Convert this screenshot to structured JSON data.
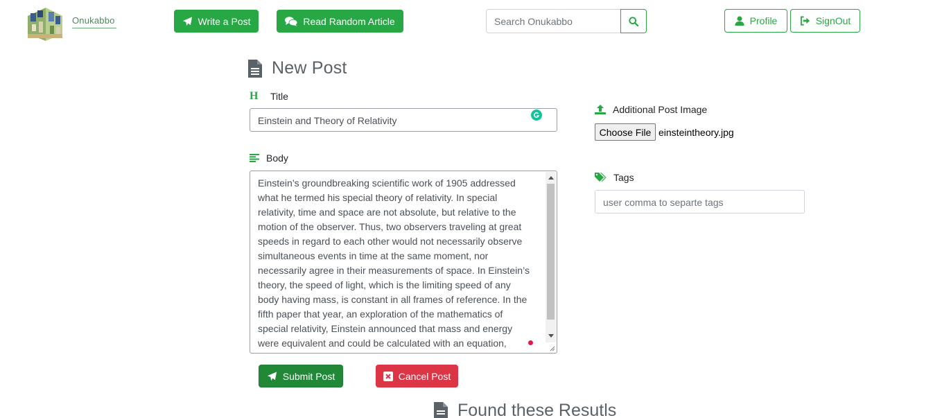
{
  "brand": {
    "name": "Onukabbo"
  },
  "nav": {
    "write_post": "Write a Post",
    "read_random": "Read Random Article",
    "search_placeholder": "Search Onukabbo",
    "profile": "Profile",
    "signout": "SignOut"
  },
  "form": {
    "heading": "New Post",
    "title_label": "Title",
    "title_value": "Einstein and Theory of Relativity",
    "body_label": "Body",
    "body_value": "Einstein’s groundbreaking scientific work of 1905 addressed\nwhat he termed his special theory of relativity. In special\nrelativity, time and space are not absolute, but relative to the\nmotion of the observer. Thus, two observers traveling at great\nspeeds in regard to each other would not necessarily observe\nsimultaneous events in time at the same moment, nor\nnecessarily agree in their measurements of space. In Einstein’s\ntheory, the speed of light, which is the limiting speed of any\nbody having mass, is constant in all frames of reference. In the\nfifth paper that year, an exploration of the mathematics of\nspecial relativity, Einstein announced that mass and energy\nwere equivalent and could be calculated with an equation,",
    "image_label": "Additional Post Image",
    "choose_file": "Choose File",
    "file_name": "einsteintheory.jpg",
    "tags_label": "Tags",
    "tags_placeholder": "user comma to separte tags",
    "submit": "Submit Post",
    "cancel": "Cancel Post"
  },
  "results": {
    "heading": "Found these Resutls"
  },
  "colors": {
    "accent": "#28a745",
    "accent_dark": "#218838",
    "danger": "#dc3545",
    "heading": "#5a6268"
  }
}
